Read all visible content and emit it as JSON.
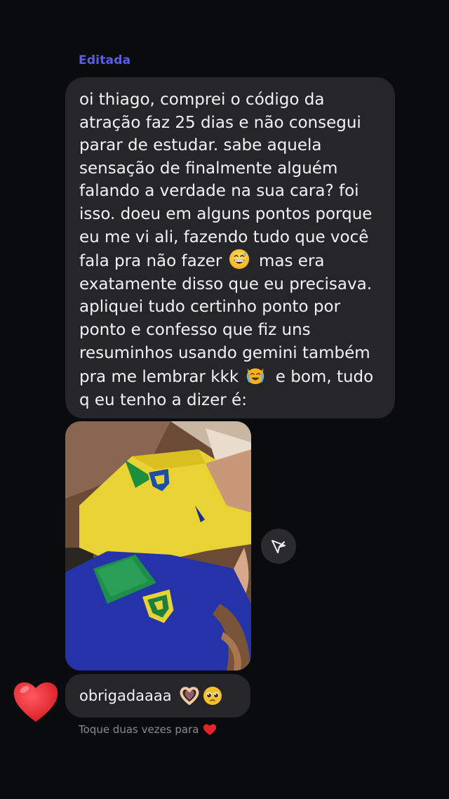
{
  "conversation": {
    "edited_label": "Editada",
    "message": {
      "lines": [
        "oi thiago, comprei o código da",
        "atração faz 25 dias e não consegui",
        "parar de estudar. sabe aquela",
        "sensação de finalmente alguém",
        "falando a verdade na sua cara? foi",
        "isso. doeu em alguns pontos porque",
        "eu me vi ali, fazendo tudo que você"
      ],
      "line8_before_emoji": "fala pra não fazer",
      "line8_emoji": "grinning-sweat-emoji",
      "line8_after_emoji": "mas era",
      "lines_after": [
        "exatamente disso que eu precisava.",
        "apliquei tudo certinho ponto por",
        "ponto e confesso que fiz uns",
        "resuminhos usando gemini também"
      ],
      "line13_before_emoji": "pra me lembrar kkk",
      "line13_emoji": "crying-cat-emoji",
      "line13_after_emoji": "e bom, tudo",
      "last_line": "q eu tenho a dizer é:"
    },
    "photo": {
      "description_icon": "photo-brasil-jerseys"
    },
    "share_button_icon": "send-icon",
    "reply": {
      "text": "obrigadaaaa",
      "emojis": [
        "heart-hands-emoji",
        "pleading-face-emoji"
      ]
    },
    "reaction": {
      "icon": "red-heart-icon",
      "color": "#e3242b"
    },
    "hint": {
      "text": "Toque duas vezes para",
      "icon": "small-heart-icon"
    }
  },
  "colors": {
    "background": "#0a0b0d",
    "bubble": "#262628",
    "edited_label": "#5b5fe0",
    "hint_text": "#8b8b8f"
  }
}
